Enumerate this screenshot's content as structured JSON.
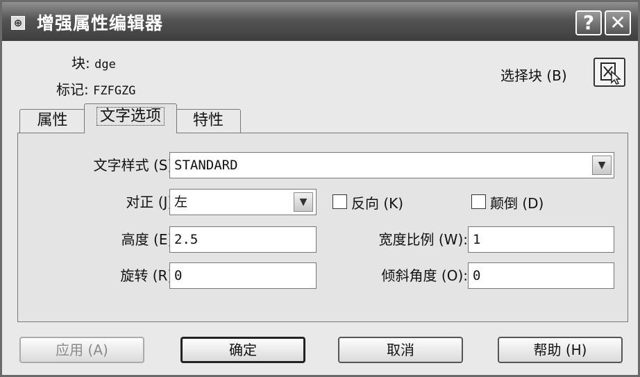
{
  "window": {
    "title": "增强属性编辑器",
    "help_glyph": "?",
    "close_glyph": "✕",
    "icon": "app-icon"
  },
  "block_info": {
    "block_label": "块:",
    "block_value": "dge",
    "tag_label": "标记:",
    "tag_value": "FZFGZG",
    "select_block_label": "选择块 (B)"
  },
  "tabs": [
    {
      "label": "属性"
    },
    {
      "label": "文字选项"
    },
    {
      "label": "特性"
    }
  ],
  "text_options": {
    "style_label": "文字样式 (S):",
    "style_value": "STANDARD",
    "justify_label": "对正 (J):",
    "justify_value": "左",
    "backwards_label": "反向 (K)",
    "upside_down_label": "颠倒 (D)",
    "height_label": "高度 (E):",
    "height_value": "2.5",
    "width_factor_label": "宽度比例 (W):",
    "width_factor_value": "1",
    "rotation_label": "旋转 (R):",
    "rotation_value": "0",
    "oblique_label": "倾斜角度 (O):",
    "oblique_value": "0"
  },
  "buttons": {
    "apply": "应用 (A)",
    "ok": "确定",
    "cancel": "取消",
    "help": "帮助 (H)"
  },
  "dropdown_glyph": "▼"
}
